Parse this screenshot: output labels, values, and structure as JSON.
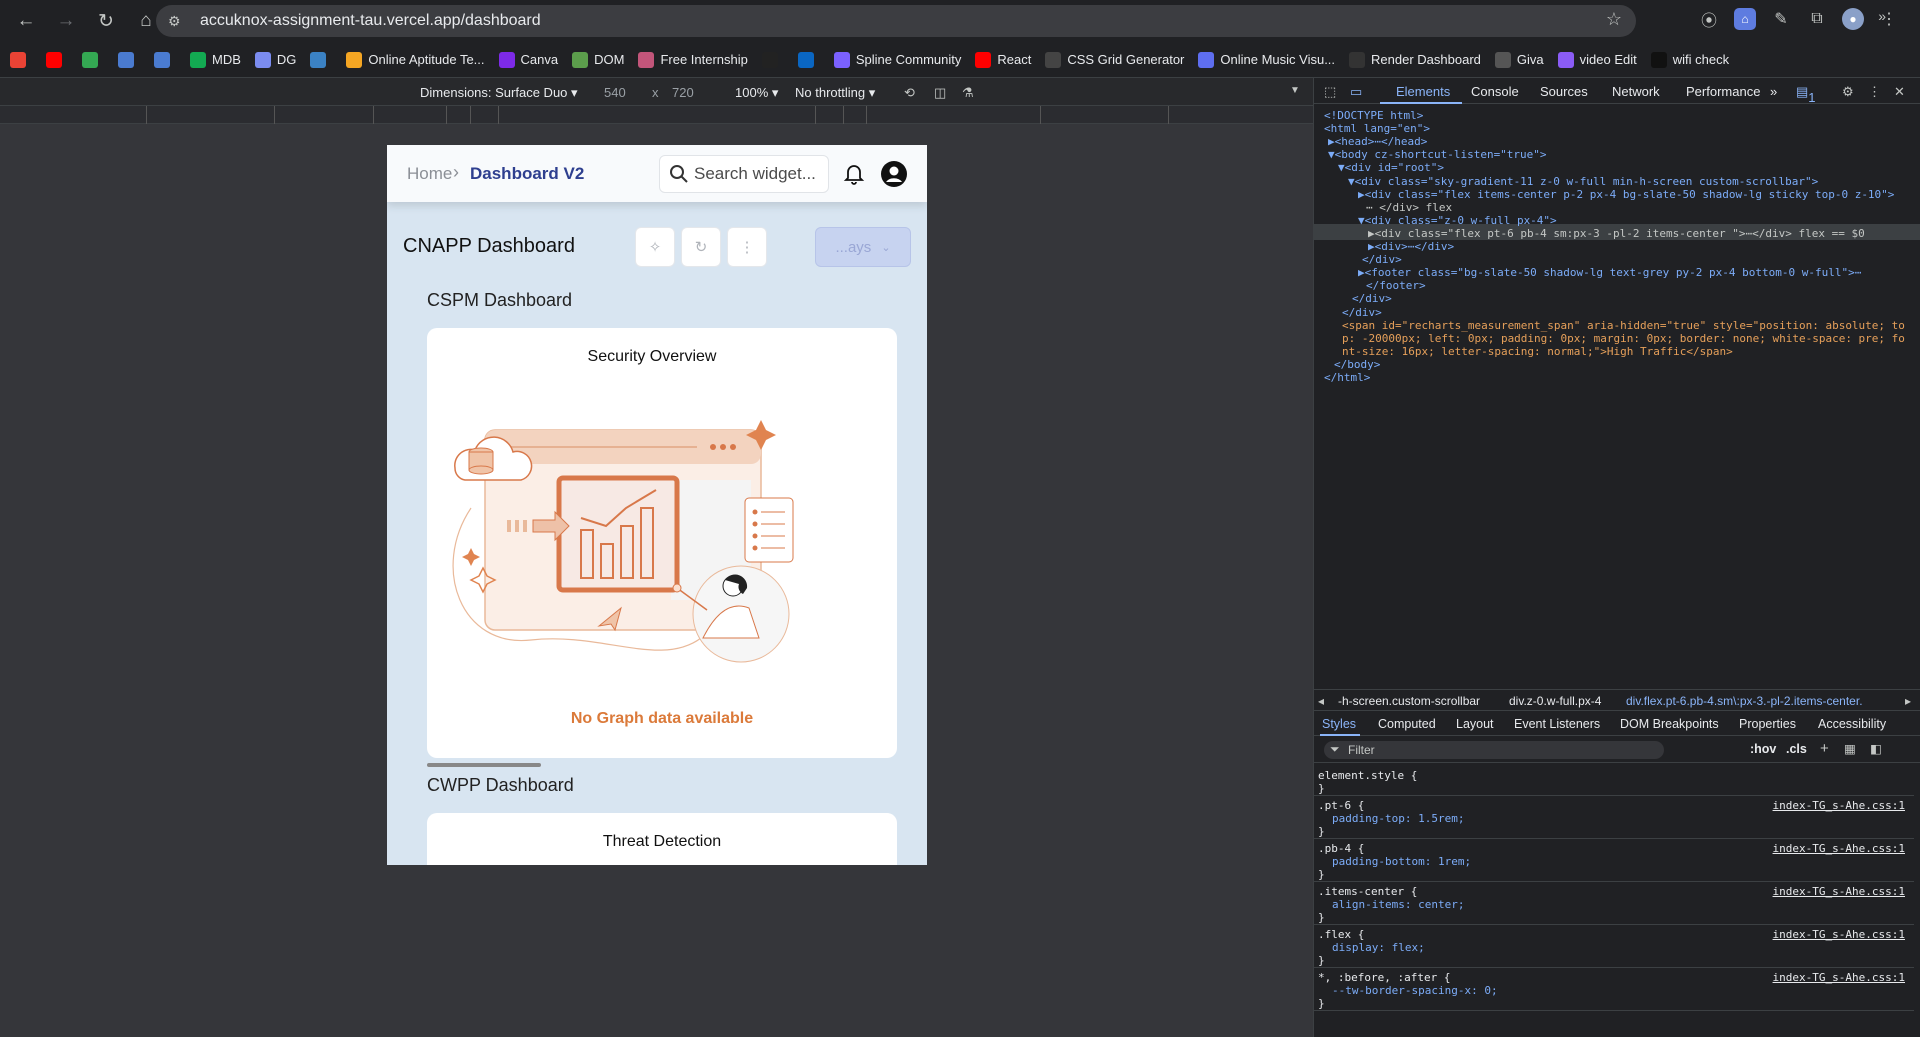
{
  "browser": {
    "url": "accuknox-assignment-tau.vercel.app/dashboard",
    "bookmarks": [
      {
        "label": "",
        "icon": "gmail-icon",
        "color": "#ea4335"
      },
      {
        "label": "",
        "icon": "youtube-icon",
        "color": "#ff0000"
      },
      {
        "label": "",
        "icon": "maps-icon",
        "color": "#34a853"
      },
      {
        "label": "",
        "icon": "gfg-icon",
        "color": "#4a7bd0"
      },
      {
        "label": "",
        "icon": "translate-icon",
        "color": "#4a7bd0"
      },
      {
        "label": "MDB",
        "icon": "mongodb-icon",
        "color": "#13aa52"
      },
      {
        "label": "DG",
        "icon": "cloud-icon",
        "color": "#7b8cf0"
      },
      {
        "label": "",
        "icon": "ibb-icon",
        "color": "#3b82c4"
      },
      {
        "label": "Online Aptitude Te...",
        "icon": "umbrella-icon",
        "color": "#f5a623"
      },
      {
        "label": "Canva",
        "icon": "canva-icon",
        "color": "#7d2ae8"
      },
      {
        "label": "DOM",
        "icon": "dom-icon",
        "color": "#5c9e4c"
      },
      {
        "label": "Free Internship",
        "icon": "internship-icon",
        "color": "#c2557a"
      },
      {
        "label": "",
        "icon": "amazon-icon",
        "color": "#222222"
      },
      {
        "label": "",
        "icon": "linkedin-icon",
        "color": "#0a66c2"
      },
      {
        "label": "Spline Community",
        "icon": "spline-icon",
        "color": "#7b61ff"
      },
      {
        "label": "React",
        "icon": "youtube-icon",
        "color": "#ff0000"
      },
      {
        "label": "CSS Grid Generator",
        "icon": "grid-icon",
        "color": "#444444"
      },
      {
        "label": "Online Music Visu...",
        "icon": "play-icon",
        "color": "#5e6ef0"
      },
      {
        "label": "Render Dashboard",
        "icon": "render-icon",
        "color": "#333333"
      },
      {
        "label": "Giva",
        "icon": "giva-icon",
        "color": "#555555"
      },
      {
        "label": "video Edit",
        "icon": "video-icon",
        "color": "#8b5cf6"
      },
      {
        "label": "wifi check",
        "icon": "d-icon",
        "color": "#111111"
      }
    ]
  },
  "device_toolbar": {
    "dimensions": "Dimensions: Surface Duo ▾",
    "width": "540",
    "x": "x",
    "height": "720",
    "zoom": "100% ▾",
    "throttling": "No throttling ▾"
  },
  "app": {
    "breadcrumb_home": "Home",
    "breadcrumb_sep": "›",
    "breadcrumb_current": "Dashboard V2",
    "search_placeholder": "Search widget...",
    "page_title": "CNAPP Dashboard",
    "range_label": "...ays",
    "sections": [
      {
        "title": "CSPM Dashboard",
        "widget_title": "Security Overview",
        "empty_text": "No Graph data available"
      },
      {
        "title": "CWPP Dashboard",
        "widget_title": "Threat Detection"
      }
    ]
  },
  "devtools": {
    "tabs": [
      "Elements",
      "Console",
      "Sources",
      "Network",
      "Performance",
      "»"
    ],
    "issues_badge": "1",
    "breadcrumbs": [
      "-h-screen.custom-scrollbar",
      "div.z-0.w-full.px-4",
      "div.flex.pt-6.pb-4.sm\\:px-3.-pl-2.items-center."
    ],
    "subtabs": [
      "Styles",
      "Computed",
      "Layout",
      "Event Listeners",
      "DOM Breakpoints",
      "Properties",
      "Accessibility"
    ],
    "filter_placeholder": "Filter",
    "hov": ":hov",
    "cls": ".cls",
    "dom_lines": [
      "<!DOCTYPE html>",
      "<html lang=\"en\">",
      "▶<head>⋯</head>",
      "▼<body cz-shortcut-listen=\"true\">",
      "▼<div id=\"root\">",
      "▼<div class=\"sky-gradient-11 z-0 w-full min-h-screen custom-scrollbar\">",
      "▶<div class=\"flex items-center p-2 px-4 bg-slate-50 shadow-lg sticky top-0 z-10\">",
      "⋯ </div> flex",
      "▼<div class=\"z-0 w-full px-4\">",
      "▶<div class=\"flex pt-6 pb-4 sm:px-3 -pl-2 items-center \">⋯</div> flex == $0",
      "▶<div>⋯</div>",
      "</div>",
      "▶<footer class=\"bg-slate-50 shadow-lg text-grey py-2 px-4 bottom-0 w-full\">⋯",
      "</footer>",
      "</div>",
      "</div>",
      "<span id=\"recharts_measurement_span\" aria-hidden=\"true\" style=\"position: absolute; to",
      "p: -20000px; left: 0px; padding: 0px; margin: 0px; border: none; white-space: pre; fo",
      "nt-size: 16px; letter-spacing: normal;\">High Traffic</span>",
      "</body>",
      "</html>"
    ],
    "style_rules": [
      {
        "selector": "element.style {",
        "prop": "",
        "source": ""
      },
      {
        "selector": ".pt-6 {",
        "prop": "padding-top: 1.5rem;",
        "source": "index-TG_s-Ahe.css:1"
      },
      {
        "selector": ".pb-4 {",
        "prop": "padding-bottom: 1rem;",
        "source": "index-TG_s-Ahe.css:1"
      },
      {
        "selector": ".items-center {",
        "prop": "align-items: center;",
        "source": "index-TG_s-Ahe.css:1"
      },
      {
        "selector": ".flex {",
        "prop": "display: flex;",
        "source": "index-TG_s-Ahe.css:1"
      },
      {
        "selector": "*, :before, :after {",
        "prop": "--tw-border-spacing-x: 0;",
        "source": "index-TG_s-Ahe.css:1"
      }
    ]
  }
}
